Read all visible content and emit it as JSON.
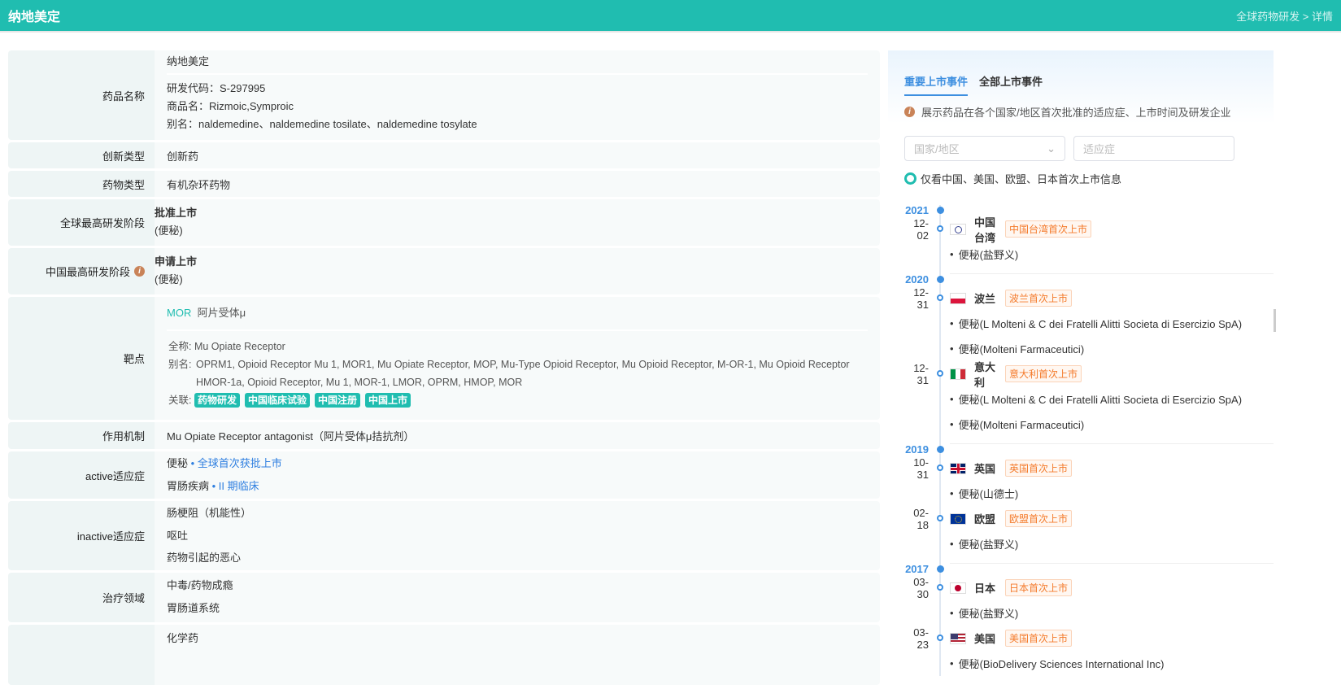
{
  "header": {
    "title": "纳地美定",
    "breadcrumb": "全球药物研发 > 详情"
  },
  "rows": {
    "name": {
      "label": "药品名称",
      "cn": "纳地美定",
      "code": "研发代码：S-297995",
      "trade": "商品名：Rizmoic,Symproic",
      "alias": "别名：naldemedine、naldemedine tosilate、naldemedine tosylate"
    },
    "innovation": {
      "label": "创新类型",
      "value": "创新药"
    },
    "drugtype": {
      "label": "药物类型",
      "value": "有机杂环药物"
    },
    "global_stage": {
      "label": "全球最高研发阶段",
      "value": "批准上市",
      "sub": "(便秘)"
    },
    "china_stage": {
      "label": "中国最高研发阶段",
      "value": "申请上市",
      "sub": "(便秘)"
    },
    "target": {
      "label": "靶点",
      "symbol": "MOR",
      "name": "阿片受体μ",
      "fullname_label": "全称:",
      "fullname": "Mu Opiate Receptor",
      "alias_label": "别名:",
      "alias1": "OPRM1, Opioid Receptor Mu 1, MOR1, Mu Opiate Receptor, MOP, Mu-Type Opioid Receptor, Mu Opioid Receptor, M-OR-1, Mu Opioid Receptor",
      "alias2": "HMOR-1a, Opioid Receptor, Mu 1, MOR-1, LMOR, OPRM, HMOP, MOR",
      "related_label": "关联:",
      "tags": [
        "药物研发",
        "中国临床试验",
        "中国注册",
        "中国上市"
      ]
    },
    "mechanism": {
      "label": "作用机制",
      "value": "Mu Opiate Receptor antagonist（阿片受体μ拮抗剂）"
    },
    "active": {
      "label": "active适应症",
      "items": [
        {
          "name": "便秘",
          "status": "• 全球首次获批上市"
        },
        {
          "name": "胃肠疾病",
          "status": "• II 期临床"
        }
      ]
    },
    "inactive": {
      "label": "inactive适应症",
      "items": [
        "肠梗阻（机能性）",
        "呕吐",
        "药物引起的恶心"
      ]
    },
    "therapy": {
      "label": "治疗领域",
      "items": [
        "中毒/药物成瘾",
        "胃肠道系统"
      ]
    },
    "last": {
      "items": [
        "化学药"
      ]
    }
  },
  "panel": {
    "tabs": [
      "重要上市事件",
      "全部上市事件"
    ],
    "note": "展示药品在各个国家/地区首次批准的适应症、上市时间及研发企业",
    "country_placeholder": "国家/地区",
    "indication_placeholder": "适应症",
    "only_label": "仅看中国、美国、欧盟、日本首次上市信息",
    "years": [
      {
        "year": "2021",
        "events": [
          {
            "date": "12-02",
            "flag": "tw",
            "country": "中国台湾",
            "badge": "中国台湾首次上市",
            "items": [
              "便秘(盐野义)"
            ]
          }
        ]
      },
      {
        "year": "2020",
        "events": [
          {
            "date": "12-31",
            "flag": "pl",
            "country": "波兰",
            "badge": "波兰首次上市",
            "items": [
              "便秘(L Molteni & C dei Fratelli Alitti Societa di Esercizio SpA)",
              "便秘(Molteni Farmaceutici)"
            ]
          },
          {
            "date": "12-31",
            "flag": "it",
            "country": "意大利",
            "badge": "意大利首次上市",
            "items": [
              "便秘(L Molteni & C dei Fratelli Alitti Societa di Esercizio SpA)",
              "便秘(Molteni Farmaceutici)"
            ]
          }
        ]
      },
      {
        "year": "2019",
        "events": [
          {
            "date": "10-31",
            "flag": "uk",
            "country": "英国",
            "badge": "英国首次上市",
            "items": [
              "便秘(山德士)"
            ]
          },
          {
            "date": "02-18",
            "flag": "eu",
            "country": "欧盟",
            "badge": "欧盟首次上市",
            "items": [
              "便秘(盐野义)"
            ]
          }
        ]
      },
      {
        "year": "2017",
        "events": [
          {
            "date": "03-30",
            "flag": "jp",
            "country": "日本",
            "badge": "日本首次上市",
            "items": [
              "便秘(盐野义)"
            ]
          },
          {
            "date": "03-23",
            "flag": "us",
            "country": "美国",
            "badge": "美国首次上市",
            "items": [
              "便秘(BioDelivery Sciences International Inc)"
            ]
          }
        ]
      }
    ]
  }
}
